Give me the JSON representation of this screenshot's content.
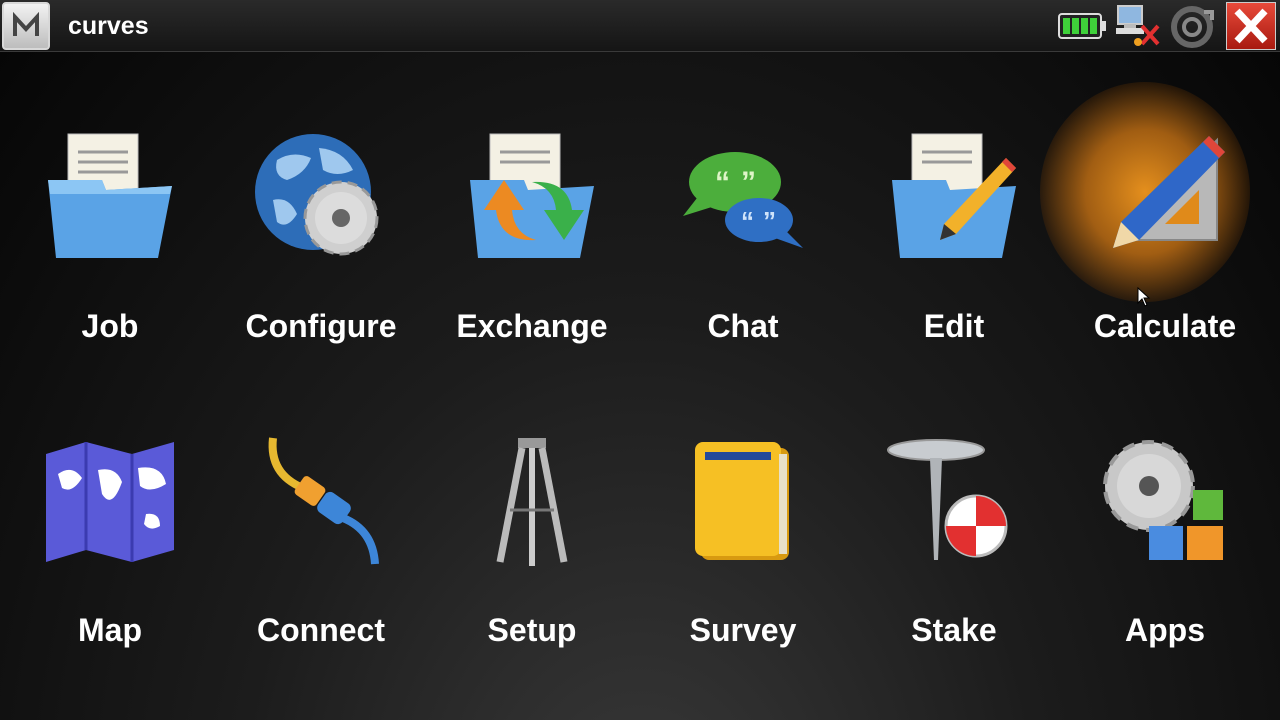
{
  "window": {
    "title": "curves",
    "menu_icon": "m-logo-icon"
  },
  "status_icons": [
    "battery-icon",
    "network-disconnected-icon",
    "sync-icon",
    "close-icon"
  ],
  "highlight_color": "#f0961e",
  "tiles_row1": [
    {
      "label": "Job",
      "icon": "folder-document-icon"
    },
    {
      "label": "Configure",
      "icon": "globe-gear-icon"
    },
    {
      "label": "Exchange",
      "icon": "folder-exchange-icon"
    },
    {
      "label": "Chat",
      "icon": "chat-bubbles-icon"
    },
    {
      "label": "Edit",
      "icon": "folder-pencil-icon"
    },
    {
      "label": "Calculate",
      "icon": "pencil-ruler-icon"
    }
  ],
  "tiles_row2": [
    {
      "label": "Map",
      "icon": "map-icon"
    },
    {
      "label": "Connect",
      "icon": "cable-icon"
    },
    {
      "label": "Setup",
      "icon": "tripod-icon"
    },
    {
      "label": "Survey",
      "icon": "notebook-icon"
    },
    {
      "label": "Stake",
      "icon": "stake-marker-icon"
    },
    {
      "label": "Apps",
      "icon": "gear-blocks-icon"
    }
  ]
}
